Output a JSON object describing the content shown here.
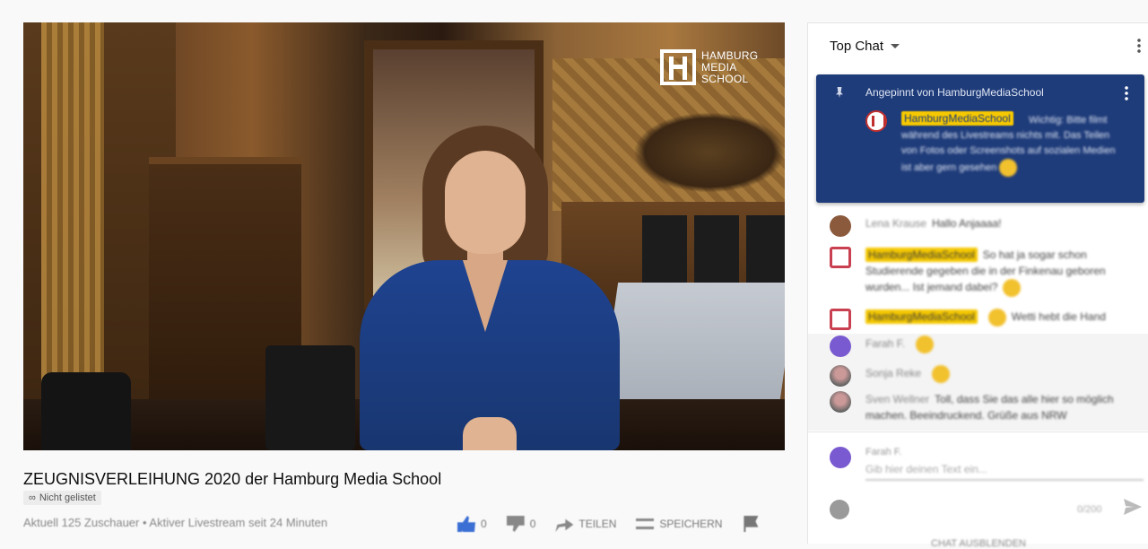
{
  "video": {
    "watermark_lines": [
      "HAMBURG",
      "MEDIA",
      "SCHOOL"
    ]
  },
  "info": {
    "title": "ZEUGNISVERLEIHUNG 2020 der Hamburg Media School",
    "visibility_badge": "Nicht gelistet",
    "meta": "Aktuell 125 Zuschauer • Aktiver Livestream seit 24 Minuten",
    "actions": {
      "like_count": "0",
      "dislike_count": "0",
      "share_label": "TEILEN",
      "save_label": "SPEICHERN"
    }
  },
  "chat": {
    "header": "Top Chat",
    "pinned": {
      "label": "Angepinnt von HamburgMediaSchool",
      "author": "HamburgMediaSchool",
      "text": "Wichtig: Bitte filmt während des Livestreams nichts mit. Das Teilen von Fotos oder Screenshots auf sozialen Medien ist aber gern gesehen"
    },
    "messages": [
      {
        "author": "Lena Krause",
        "text": "Hallo Anjaaaa!",
        "owner": false,
        "emoji": false
      },
      {
        "author": "HamburgMediaSchool",
        "text": "So hat ja sogar schon Studierende gegeben die in der Finkenau geboren wurden... Ist jemand dabei?",
        "owner": true,
        "emoji": true
      },
      {
        "author": "HamburgMediaSchool",
        "text": "Wetti hebt die Hand",
        "owner": true,
        "emoji": true
      },
      {
        "author": "Farah F.",
        "text": "",
        "owner": false,
        "emoji": true
      },
      {
        "author": "Sonja Reke",
        "text": "",
        "owner": false,
        "emoji": true
      },
      {
        "author": "Sven Wellner",
        "text": "Toll, dass Sie das alle hier so möglich machen. Beeindruckend. Grüße aus NRW",
        "owner": false,
        "emoji": false
      }
    ],
    "composer": {
      "name": "Farah F.",
      "placeholder": "Gib hier deinen Text ein...",
      "counter": "0/200",
      "hide_label": "CHAT AUSBLENDEN"
    }
  }
}
